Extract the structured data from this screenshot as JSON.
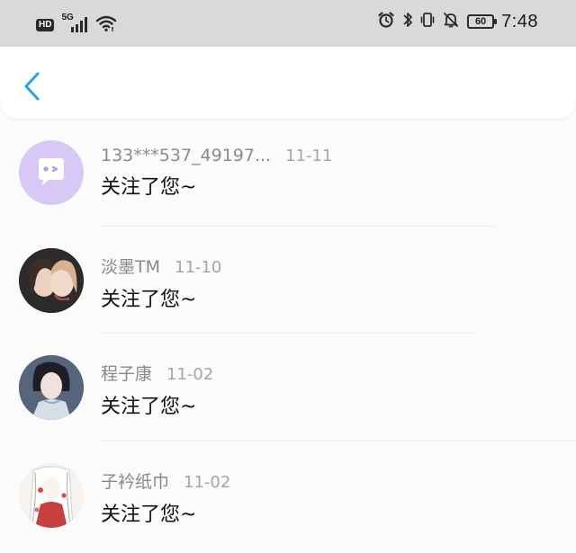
{
  "status_bar": {
    "hd_label": "HD",
    "network_label": "5G",
    "battery_level": "60",
    "time": "7:48",
    "icons": [
      "signal-icon",
      "wifi-icon",
      "alarm-icon",
      "bluetooth-icon",
      "vibrate-icon",
      "mute-icon",
      "battery-icon"
    ]
  },
  "nav": {
    "back_icon": "chevron-left-icon",
    "accent_color": "#2a9df4"
  },
  "notifications": [
    {
      "username": "133***537_49197...",
      "date": "11-11",
      "message": "关注了您~",
      "avatar": "chat-bubble-avatar"
    },
    {
      "username": "淡墨TM",
      "date": "11-10",
      "message": "关注了您~",
      "avatar": "photo-avatar"
    },
    {
      "username": "程子康",
      "date": "11-02",
      "message": "关注了您~",
      "avatar": "photo-avatar"
    },
    {
      "username": "子衿纸巾",
      "date": "11-02",
      "message": "关注了您~",
      "avatar": "illustration-avatar"
    }
  ]
}
